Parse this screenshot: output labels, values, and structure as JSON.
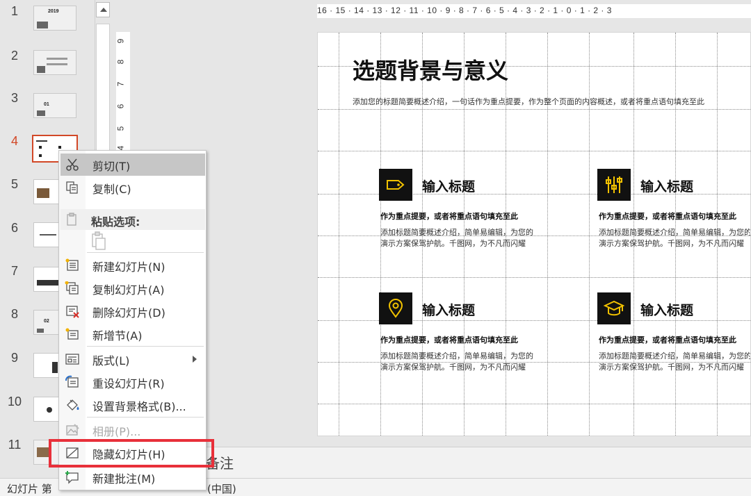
{
  "thumbnails": [
    {
      "num": "1",
      "text": "2019"
    },
    {
      "num": "2",
      "text": ""
    },
    {
      "num": "3",
      "text": "01"
    },
    {
      "num": "4",
      "text": ""
    },
    {
      "num": "5",
      "text": ""
    },
    {
      "num": "6",
      "text": ""
    },
    {
      "num": "7",
      "text": ""
    },
    {
      "num": "8",
      "text": "02"
    },
    {
      "num": "9",
      "text": ""
    },
    {
      "num": "10",
      "text": ""
    },
    {
      "num": "11",
      "text": ""
    }
  ],
  "active_slide": 4,
  "ruler": {
    "horizontal": "16 · 15 · 14 · 13 · 12 · 11 · 10 · 9 · 8 · 7 · 6 · 5 · 4 · 3 · 2 · 1 · 0 · 1 · 2 · 3",
    "vertical": [
      "9",
      "8",
      "7",
      "6",
      "5",
      "4"
    ]
  },
  "slide": {
    "title": "选题背景与意义",
    "subtitle": "添加您的标题简要概述介绍，一句话作为重点提要，作为整个页面的内容概述，或者将重点语句填充至此",
    "cards": [
      {
        "icon": "tag-icon",
        "title": "输入标题",
        "emph": "作为重点提要，或者将重点语句填充至此",
        "body": "添加标题简要概述介绍，简单易编辑，为您的演示方案保驾护航。千图网，为不凡而闪耀"
      },
      {
        "icon": "sliders-icon",
        "title": "输入标题",
        "emph": "作为重点提要，或者将重点语句填充至此",
        "body": "添加标题简要概述介绍，简单易编辑，为您的演示方案保驾护航。千图网，为不凡而闪耀"
      },
      {
        "icon": "location-pin-icon",
        "title": "输入标题",
        "emph": "作为重点提要，或者将重点语句填充至此",
        "body": "添加标题简要概述介绍，简单易编辑，为您的演示方案保驾护航。千图网，为不凡而闪耀"
      },
      {
        "icon": "graduation-cap-icon",
        "title": "输入标题",
        "emph": "作为重点提要，或者将重点语句填充至此",
        "body": "添加标题简要概述介绍，简单易编辑，为您的演示方案保驾护航。千图网，为不凡而闪耀"
      }
    ]
  },
  "context_menu": {
    "cut": "剪切(T)",
    "copy": "复制(C)",
    "paste_options": "粘贴选项:",
    "new_slide": "新建幻灯片(N)",
    "duplicate_slide": "复制幻灯片(A)",
    "delete_slide": "删除幻灯片(D)",
    "add_section": "新增节(A)",
    "layout": "版式(L)",
    "reset_slide": "重设幻灯片(R)",
    "format_background": "设置背景格式(B)...",
    "photo_album": "相册(P)...",
    "hide_slide": "隐藏幻灯片(H)",
    "new_comment": "新建批注(M)"
  },
  "notes": {
    "label": "备注"
  },
  "status": {
    "slide_info": "幻灯片 第",
    "language": "(中国)"
  },
  "colors": {
    "accent": "#d24726",
    "highlight": "#e8303a",
    "icon_stroke": "#f2c200"
  }
}
